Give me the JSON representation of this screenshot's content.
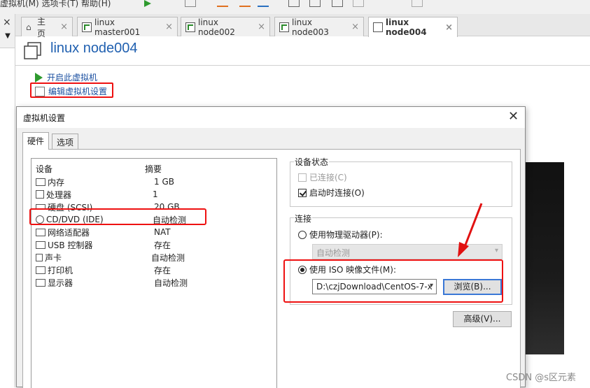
{
  "topbar": {
    "menu_text": "虚拟机(M)    选项卡(T)    帮助(H)"
  },
  "left_panel": {
    "close_glyph": "×",
    "dropdown_glyph": "▼"
  },
  "tabs": [
    {
      "label": "主页",
      "icon": "home-icon",
      "active": false
    },
    {
      "label": "linux master001",
      "icon": "vm-icon",
      "active": false
    },
    {
      "label": "linux node002",
      "icon": "vm-icon",
      "active": false
    },
    {
      "label": "linux node003",
      "icon": "vm-icon",
      "active": false
    },
    {
      "label": "linux node004",
      "icon": "vm-icon",
      "active": true
    }
  ],
  "tab_close_glyph": "×",
  "vm": {
    "title": "linux node004",
    "actions": {
      "start": "开启此虚拟机",
      "edit": "编辑虚拟机设置"
    }
  },
  "dialog": {
    "title": "虚拟机设置",
    "close_glyph": "✕",
    "tabs": [
      "硬件",
      "选项"
    ],
    "device_header": "设备",
    "summary_header": "摘要",
    "devices": [
      {
        "name": "内存",
        "summary": "1 GB",
        "icon": "memory-icon"
      },
      {
        "name": "处理器",
        "summary": "1",
        "icon": "cpu-icon"
      },
      {
        "name": "硬盘 (SCSI)",
        "summary": "20 GB",
        "icon": "harddisk-icon"
      },
      {
        "name": "CD/DVD (IDE)",
        "summary": "自动检测",
        "icon": "cd-dvd-icon"
      },
      {
        "name": "网络适配器",
        "summary": "NAT",
        "icon": "network-icon"
      },
      {
        "name": "USB 控制器",
        "summary": "存在",
        "icon": "usb-icon"
      },
      {
        "name": "声卡",
        "summary": "自动检测",
        "icon": "sound-icon"
      },
      {
        "name": "打印机",
        "summary": "存在",
        "icon": "printer-icon"
      },
      {
        "name": "显示器",
        "summary": "自动检测",
        "icon": "display-icon"
      }
    ],
    "device_status": {
      "title": "设备状态",
      "connected_label": "已连接(C)",
      "connected_checked": false,
      "connected_enabled": false,
      "connect_on_power_label": "启动时连接(O)",
      "connect_on_power_checked": true
    },
    "connection": {
      "title": "连接",
      "physical_label": "使用物理驱动器(P):",
      "physical_selected": false,
      "physical_value": "自动检测",
      "iso_label": "使用 ISO 映像文件(M):",
      "iso_selected": true,
      "iso_path": "D:\\czjDownload\\CentOS-7-x",
      "browse_label": "浏览(B)...",
      "advanced_label": "高级(V)..."
    }
  },
  "watermark": "CSDN @s区元素",
  "colors": {
    "highlight": "#e11111",
    "title_blue": "#2060b0",
    "start_green": "#2e9a2e"
  }
}
